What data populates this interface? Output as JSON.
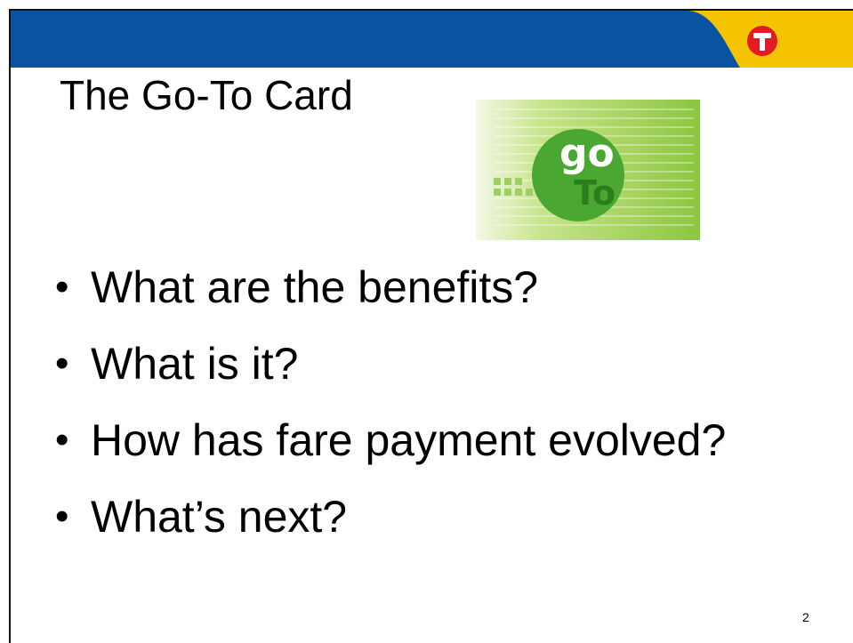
{
  "slide": {
    "title": "The Go-To Card",
    "page_number": "2",
    "logo_letter": "T",
    "card_image": {
      "brand_top": "go",
      "brand_bottom": "To"
    },
    "bullets": [
      "What are the benefits?",
      "What is it?",
      "How has fare payment evolved?",
      "What’s next?"
    ]
  },
  "colors": {
    "header_blue": "#0a53a3",
    "header_gold": "#f5c400",
    "logo_red": "#e31b23",
    "card_green": "#8cc63f",
    "card_circle": "#4aa832"
  }
}
